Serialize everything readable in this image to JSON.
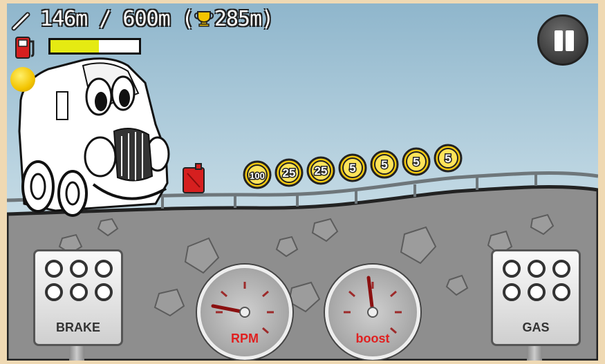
{
  "hud": {
    "distance_text": "146m / 600m (",
    "record_text": "285m)",
    "fuel_level": 0.55
  },
  "coins": [
    "100",
    "25",
    "25",
    "5",
    "5",
    "5",
    "5"
  ],
  "controls": {
    "brake_label": "BRAKE",
    "gas_label": "GAS"
  },
  "gauges": {
    "rpm_label": "RPM",
    "boost_label": "boost"
  },
  "colors": {
    "fuel_fill": "#e5ea12",
    "coin_gold": "#f6c90e",
    "fuel_can": "#d61f1f",
    "gauge_needle": "#8b1010"
  },
  "icons": [
    "distance-icon",
    "trophy-icon",
    "fuel-pump-icon",
    "coin-icon",
    "pause-icon",
    "fuel-can-icon"
  ]
}
